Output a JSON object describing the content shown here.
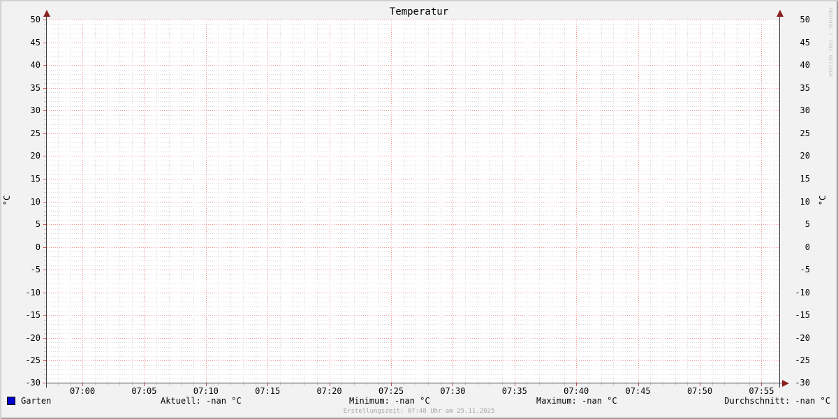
{
  "chart_data": {
    "type": "line",
    "title": "Temperatur",
    "xlabel": "",
    "ylabel": "°C",
    "ylabel_right": "°C",
    "ylim": [
      -30,
      50
    ],
    "y_major_step": 5,
    "y_minor_step": 1,
    "y_tick_labels": [
      "50",
      "45",
      "40",
      "35",
      "30",
      "25",
      "20",
      "15",
      "10",
      "5",
      "0",
      "-5",
      "-10",
      "-15",
      "-20",
      "-25",
      "-30"
    ],
    "x_tick_labels": [
      "07:00",
      "07:05",
      "07:10",
      "07:15",
      "07:20",
      "07:25",
      "07:30",
      "07:35",
      "07:40",
      "07:45",
      "07:50",
      "07:55"
    ],
    "x_minor_ticks_per_major": 5,
    "grid": true,
    "legend_position": "bottom",
    "series": [
      {
        "name": "Garten",
        "color": "#0000cc",
        "values": []
      }
    ]
  },
  "legend": {
    "series_label": "Garten",
    "series_color": "#0000cc",
    "aktuell": "Aktuell: -nan °C",
    "minimum": "Minimum: -nan °C",
    "maximum": "Maximum: -nan °C",
    "durchschnitt": "Durchschnitt: -nan °C"
  },
  "footer": {
    "creation_text": "Erstellungszeit: 07:48 Uhr am 25.11.2025"
  },
  "watermark": "RRDTOOL / TOBI OETIKER",
  "colors": {
    "background": "#f2f2f2",
    "plot_background": "#ffffff",
    "grid_minor": "#dcdcdc",
    "grid_major": "#f09898",
    "axis": "#404040",
    "arrow": "#8b2020",
    "series": "#0000cc",
    "footer_text": "#a6a6a6",
    "watermark_text": "#c4c4c4"
  }
}
